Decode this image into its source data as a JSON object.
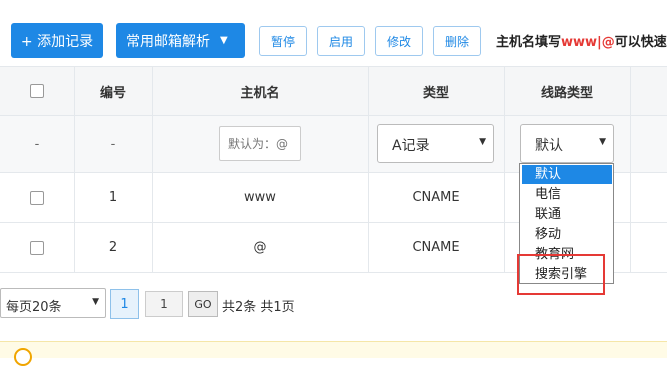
{
  "toolbar": {
    "add_label": "+ 添加记录",
    "mail_label": "常用邮箱解析",
    "mail_caret": "▼",
    "pause_label": "暂停",
    "enable_label": "启用",
    "edit_label": "修改",
    "delete_label": "删除",
    "tip_prefix": "主机名填写",
    "tip_highlight": "www|@",
    "tip_suffix": "可以快速"
  },
  "table": {
    "headers": {
      "number": "编号",
      "host": "主机名",
      "type": "类型",
      "line": "线路类型"
    },
    "new_row": {
      "checkbox_placeholder": "-",
      "number": "-",
      "host_placeholder": "默认为：@",
      "type_value": "A记录",
      "line_value": "默认"
    },
    "rows": [
      {
        "number": "1",
        "host": "www",
        "type": "CNAME"
      },
      {
        "number": "2",
        "host": "@",
        "type": "CNAME"
      }
    ]
  },
  "line_dropdown": {
    "options": [
      "默认",
      "电信",
      "联通",
      "移动",
      "教育网",
      "搜索引擎"
    ],
    "selected": "默认"
  },
  "pagination": {
    "per_page": "每页20条",
    "current_page": "1",
    "goto_value": "1",
    "go_label": "GO",
    "summary": "共2条 共1页"
  },
  "colors": {
    "accent": "#1e88e5",
    "highlight": "#e53935",
    "annotation": "#e53935"
  }
}
